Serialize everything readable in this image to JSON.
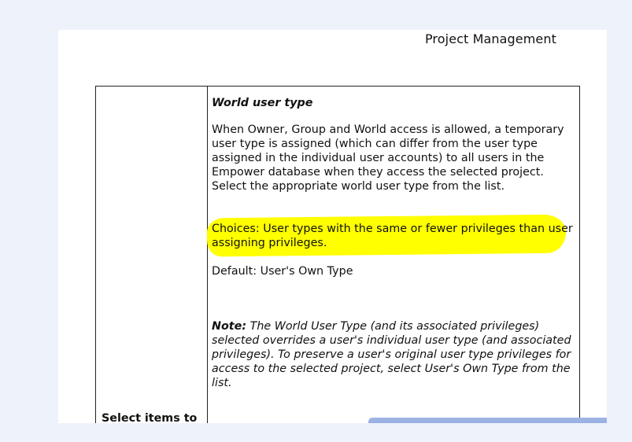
{
  "header": {
    "title": "Project Management"
  },
  "content": {
    "section_title": "World user type",
    "description": "When Owner, Group and World access is allowed, a temporary user type is assigned (which can differ from the user type assigned in the individual user accounts) to all users in the Empower database when they access the selected project. Select the appropriate world user type from the list.",
    "choices": "Choices: User types with the same or fewer privileges than user assigning privileges.",
    "default": "Default: User's Own Type",
    "note_label": "Note:",
    "note_text": " The World User Type (and its associated privileges) selected overrides a user's individual user type (and associated privileges). To preserve a user's original user type privileges for access to the selected project, select User's Own Type from the list."
  },
  "next_row": {
    "label": "Select items to"
  },
  "colors": {
    "highlight": "#ffff00",
    "background": "#eef2fa"
  }
}
